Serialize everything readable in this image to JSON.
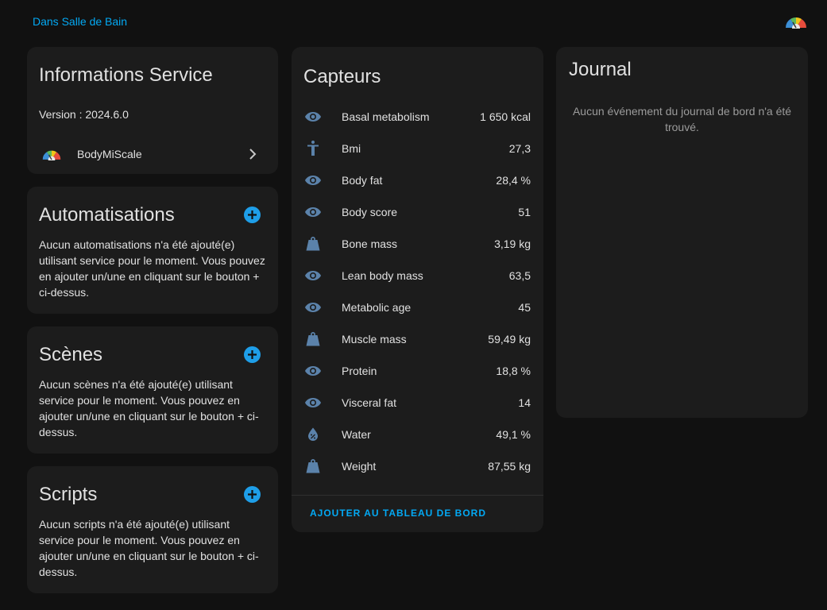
{
  "header": {
    "area_link": "Dans Salle de Bain",
    "logo_icon": "bodymiscale-gauge-icon"
  },
  "info_card": {
    "title": "Informations Service",
    "version": "Version : 2024.6.0",
    "device_name": "BodyMiScale",
    "device_icon": "bodymiscale-gauge-icon"
  },
  "automations": {
    "title": "Automatisations",
    "description": "Aucun automatisations n'a été ajouté(e) utilisant service pour le moment. Vous pouvez en ajouter un/une en cliquant sur le bouton + ci-dessus."
  },
  "scenes": {
    "title": "Scènes",
    "description": "Aucun scènes n'a été ajouté(e) utilisant service pour le moment. Vous pouvez en ajouter un/une en cliquant sur le bouton + ci-dessus."
  },
  "scripts": {
    "title": "Scripts",
    "description": "Aucun scripts n'a été ajouté(e) utilisant service pour le moment. Vous pouvez en ajouter un/une en cliquant sur le bouton + ci-dessus."
  },
  "sensors": {
    "title": "Capteurs",
    "items": [
      {
        "name": "Basal metabolism",
        "value": "1 650 kcal",
        "icon": "eye-icon"
      },
      {
        "name": "Bmi",
        "value": "27,3",
        "icon": "human-icon"
      },
      {
        "name": "Body fat",
        "value": "28,4 %",
        "icon": "eye-icon"
      },
      {
        "name": "Body score",
        "value": "51",
        "icon": "eye-icon"
      },
      {
        "name": "Bone mass",
        "value": "3,19 kg",
        "icon": "weight-icon"
      },
      {
        "name": "Lean body mass",
        "value": "63,5",
        "icon": "eye-icon"
      },
      {
        "name": "Metabolic age",
        "value": "45",
        "icon": "eye-icon"
      },
      {
        "name": "Muscle mass",
        "value": "59,49 kg",
        "icon": "weight-icon"
      },
      {
        "name": "Protein",
        "value": "18,8 %",
        "icon": "eye-icon"
      },
      {
        "name": "Visceral fat",
        "value": "14",
        "icon": "eye-icon"
      },
      {
        "name": "Water",
        "value": "49,1 %",
        "icon": "water-percent-icon"
      },
      {
        "name": "Weight",
        "value": "87,55 kg",
        "icon": "weight-icon"
      }
    ],
    "add_to_dashboard": "AJOUTER AU TABLEAU DE BORD"
  },
  "journal": {
    "title": "Journal",
    "empty_text": "Aucun événement du journal de bord n'a été trouvé."
  },
  "colors": {
    "background": "#111111",
    "card": "#1c1c1c",
    "accent": "#03a9f4",
    "icon": "#5b82aa"
  }
}
